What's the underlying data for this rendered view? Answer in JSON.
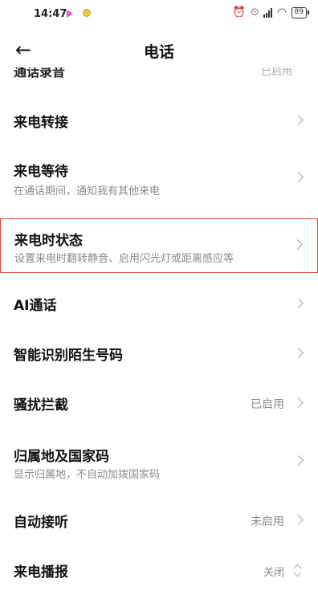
{
  "status_bar": {
    "time": "14:47",
    "battery": "89"
  },
  "header": {
    "back_icon": "arrow-left-icon",
    "title": "电话"
  },
  "clipped_row": {
    "label": "通话录音",
    "value": "已启用"
  },
  "settings": [
    {
      "label": "来电转接",
      "subtitle": "",
      "value": ""
    },
    {
      "label": "来电等待",
      "subtitle": "在通话期间，通知我有其他来电",
      "value": ""
    },
    {
      "label": "来电时状态",
      "subtitle": "设置来电时翻转静音、启用闪光灯或距离感应等",
      "value": ""
    },
    {
      "label": "AI通话",
      "subtitle": "",
      "value": ""
    },
    {
      "label": "智能识别陌生号码",
      "subtitle": "",
      "value": ""
    },
    {
      "label": "骚扰拦截",
      "subtitle": "",
      "value": "已启用"
    },
    {
      "label": "归属地及国家码",
      "subtitle": "显示归属地，不自动加拨国家码",
      "value": ""
    },
    {
      "label": "自动接听",
      "subtitle": "",
      "value": "未启用"
    },
    {
      "label": "来电播报",
      "subtitle": "",
      "value": "关闭"
    }
  ],
  "colors": {
    "highlight_border": "#e0433a",
    "secondary_text": "#8c8c8c"
  }
}
